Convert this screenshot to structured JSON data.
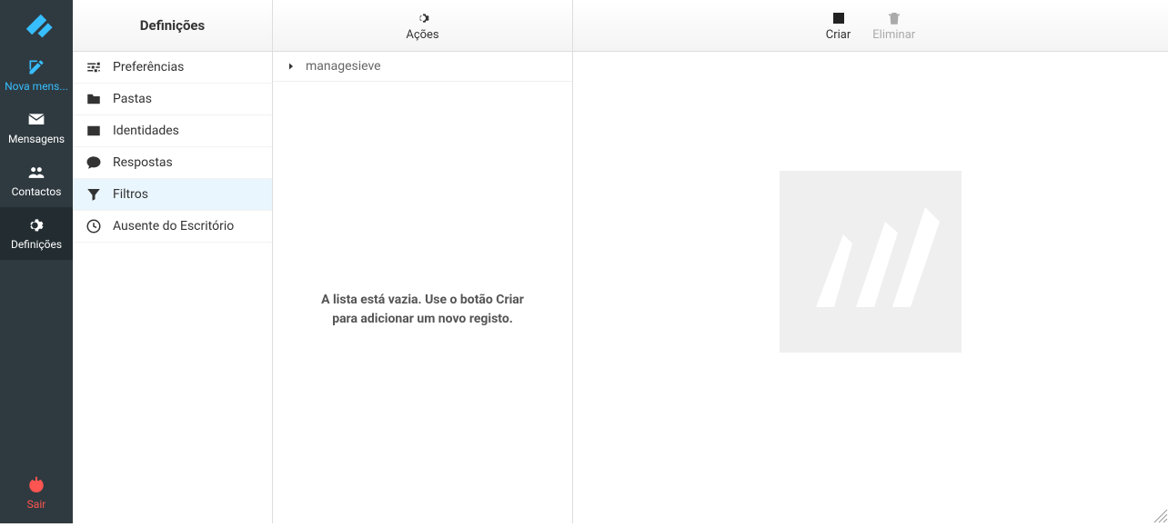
{
  "sidebar": {
    "compose_label": "Nova mens...",
    "messages_label": "Mensagens",
    "contacts_label": "Contactos",
    "settings_label": "Definições",
    "logout_label": "Sair"
  },
  "definitions": {
    "header": "Definições",
    "items": [
      {
        "label": "Preferências",
        "icon": "sliders"
      },
      {
        "label": "Pastas",
        "icon": "folder"
      },
      {
        "label": "Identidades",
        "icon": "id-card"
      },
      {
        "label": "Respostas",
        "icon": "comment"
      },
      {
        "label": "Filtros",
        "icon": "filter",
        "selected": true
      },
      {
        "label": "Ausente do Escritório",
        "icon": "clock"
      }
    ]
  },
  "actions": {
    "header_label": "Ações",
    "filter_set": "managesieve",
    "empty_message": "A lista está vazia. Use o botão Criar para adicionar um novo registo."
  },
  "main": {
    "create_label": "Criar",
    "delete_label": "Eliminar"
  }
}
